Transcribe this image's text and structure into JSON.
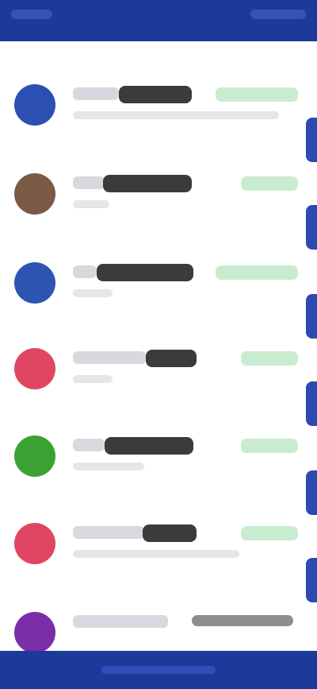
{
  "header": {
    "status_label": "",
    "app_label": ""
  },
  "list": {
    "section_label": "",
    "transactions": [
      {
        "avatar_color": "#2b4fb3",
        "title": "",
        "subtitle": "",
        "amount": ""
      },
      {
        "avatar_color": "#7b5a45",
        "title": "",
        "subtitle": "",
        "amount": ""
      },
      {
        "avatar_color": "#2f55b3",
        "title": "",
        "subtitle": "",
        "amount": ""
      },
      {
        "avatar_color": "#e04662",
        "title": "",
        "subtitle": "",
        "amount": ""
      },
      {
        "avatar_color": "#3aa233",
        "title": "",
        "subtitle": "",
        "amount": ""
      },
      {
        "avatar_color": "#e04662",
        "title": "",
        "subtitle": "",
        "amount": ""
      },
      {
        "avatar_color": "#7a2ea8",
        "title": "",
        "subtitle": "",
        "amount": ""
      }
    ]
  },
  "colors": {
    "primary": "#1d3a9b",
    "accent_tab": "#2c4ab0",
    "amount_bg": "#c9ecd0"
  }
}
